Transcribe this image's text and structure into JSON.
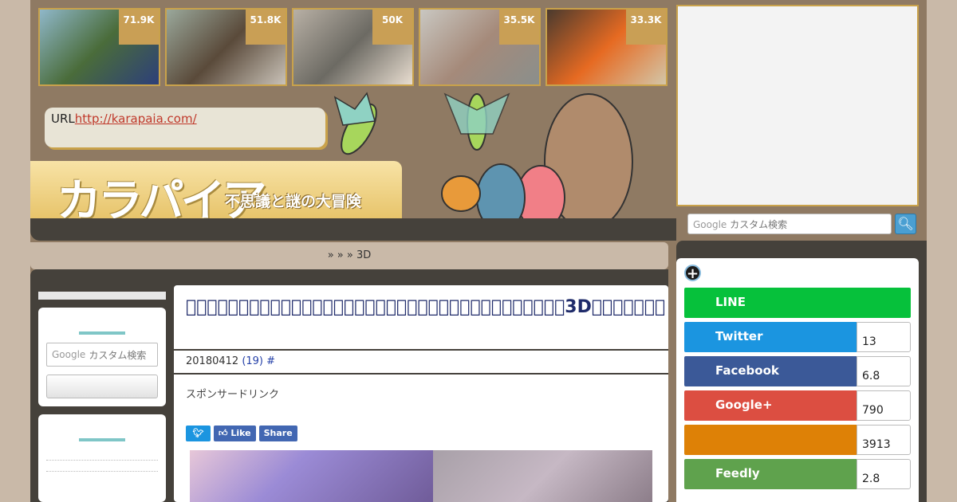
{
  "thumbnails": [
    {
      "count": "71.9K",
      "colors": [
        "#8fb7c9",
        "#4a6c3a",
        "#2d3f7a"
      ]
    },
    {
      "count": "51.8K",
      "colors": [
        "#9aa89b",
        "#5a4a3a",
        "#c9c2b8"
      ]
    },
    {
      "count": "50K",
      "colors": [
        "#b8b0a5",
        "#6c6a63",
        "#e8ddd0"
      ]
    },
    {
      "count": "35.5K",
      "colors": [
        "#c9c7c1",
        "#a58a7a",
        "#8a8f8c"
      ]
    },
    {
      "count": "33.3K",
      "colors": [
        "#4a3a2e",
        "#e66a22",
        "#d3c6a8"
      ]
    }
  ],
  "header": {
    "url_label": "URL",
    "url_link": "http://karapaia.com/",
    "logo_text": "カラパイア",
    "tagline": "不思議と謎の大冒険"
  },
  "breadcrumb": "»  »  » 3D",
  "left_sidebar": {
    "search_placeholder": "カスタム検索",
    "google_word": "Google"
  },
  "article": {
    "title": "\u0000\u0000\u0000\u0000\u0000\u0000\u0000\u0000\u0000\u0000\u0000\u0000\u0000\u0000\u0000\u0000\u0000\u0000\u0000\u0000\u0000\u0000\u0000\u0000\u0000\u0000\u0000\u0000\u0000\u0000\u0000\u0000\u0000\u0000\u0000\u00003D\u0000\u0000\u0000\u0000\u0000\u0000\u0000",
    "date": "20180412",
    "comments": "(19)",
    "hash": "#",
    "sponsor": "スポンサードリンク",
    "tweet_label": "",
    "like_label": "Like",
    "share_label": "Share"
  },
  "right_sidebar": {
    "search_placeholder": "カスタム検索",
    "google_word": "Google",
    "shares": [
      {
        "label": "LINE",
        "count": "",
        "color": "#06c13b"
      },
      {
        "label": "Twitter",
        "count": "13",
        "color": "#1b95e0"
      },
      {
        "label": "Facebook",
        "count": "6.8",
        "color": "#3b5998"
      },
      {
        "label": "Google+",
        "count": "790",
        "color": "#dc4e41"
      },
      {
        "label": "",
        "count": "3913",
        "color": "#de8106"
      },
      {
        "label": "Feedly",
        "count": "2.8",
        "color": "#5fa24d"
      }
    ]
  }
}
